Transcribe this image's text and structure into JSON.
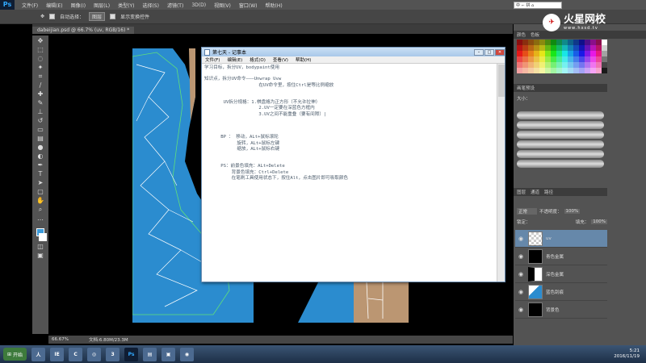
{
  "ps": {
    "app_logo": "Ps",
    "menus": [
      "文件(F)",
      "编辑(E)",
      "图像(I)",
      "图层(L)",
      "类型(Y)",
      "选择(S)",
      "滤镜(T)",
      "3D(D)",
      "视图(V)",
      "窗口(W)",
      "帮助(H)"
    ],
    "options": {
      "auto_select": "自动选择：",
      "auto_select_value": "图层",
      "show_transform": "显示变换控件"
    },
    "document_tab": "dabeijian.psd @ 66.7% (uv, RGB/16) *",
    "status_zoom": "66.67%",
    "status_doc": "文档:6.80M/23.3M",
    "ime_label": "中 ⌐ 拼 ⌂"
  },
  "panels": {
    "swatches_tabs": [
      "颜色",
      "色板"
    ],
    "brush_tabs": [
      "画笔预设"
    ],
    "brush_size_label": "大小：",
    "layers_tabs": [
      "图层",
      "通道",
      "路径"
    ],
    "blend_mode": "正常",
    "opacity_label": "不透明度：",
    "opacity_value": "100%",
    "lock_label": "锁定：",
    "fill_label": "填充：",
    "fill_value": "100%",
    "layers": [
      {
        "name": "uv",
        "active": true
      },
      {
        "name": "青色金属",
        "active": false
      },
      {
        "name": "深色金属",
        "active": false
      },
      {
        "name": "蓝色刮痕",
        "active": false
      },
      {
        "name": "背景色",
        "active": false
      }
    ]
  },
  "notepad": {
    "title": "第七天 - 记事本",
    "menus": [
      "文件(F)",
      "编辑(E)",
      "格式(O)",
      "查看(V)",
      "帮助(H)"
    ],
    "lines": [
      "学习目标，拆分UV，bodypaint使用",
      "",
      "知识点，拆分UV命令———Unwrap Uvw",
      "                    在UV命令里，按住Ctrl是等比例缩放",
      "",
      "",
      "       UV拆分规格：1.棋盘格为正方形（不允许拉伸）",
      "                    2.UV一定要在深蓝色方框内",
      "                    3.UV之间不能重叠（要有间隙）|",
      "",
      "",
      "",
      "      BP ： 移动，ALt+鼠标滚轮",
      "            旋转，ALt+鼠标左键",
      "            缩放，ALt+鼠标右键",
      "",
      "",
      "      PS：前景色填充：ALt+Delete",
      "          背景色填充：Ctrl+Delete",
      "          在笔刷工具使用状态下，按住Alt，点击图片即可吸取颜色"
    ]
  },
  "taskbar": {
    "start_label": "开始",
    "apps": [
      "人",
      "IE",
      "C",
      "◎",
      "3",
      "Ps",
      "▤",
      "▣",
      "◉"
    ],
    "time": "5:21",
    "date": "2016/11/19"
  },
  "watermark": {
    "brand": "火星网校",
    "url": "www.hxsd.tv",
    "icon": "✈"
  },
  "colors": {
    "uv_blue": "#2b8ccf",
    "skin_tan": "#bb9672",
    "ps_chrome": "#535353"
  }
}
